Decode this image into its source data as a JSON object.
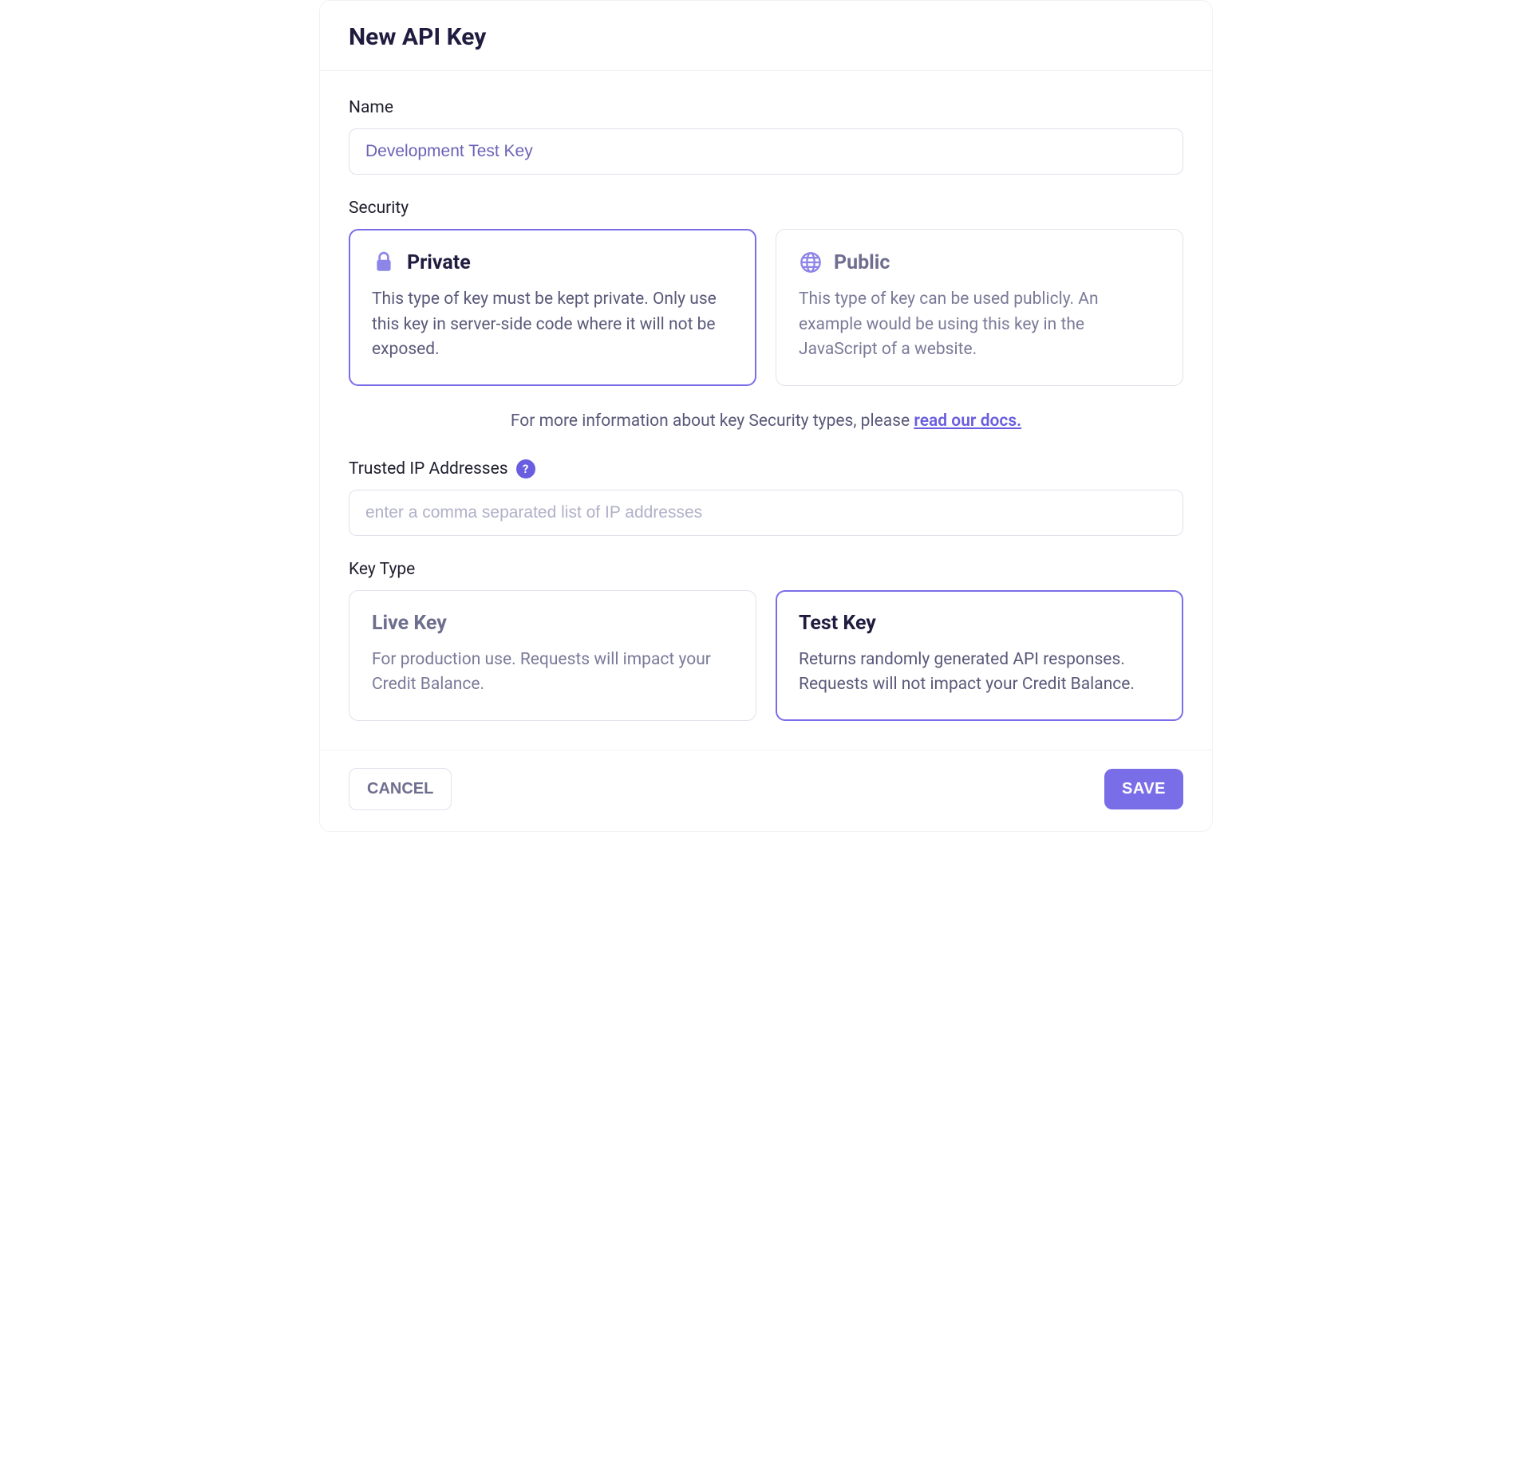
{
  "header": {
    "title": "New API Key"
  },
  "nameField": {
    "label": "Name",
    "value": "Development Test Key"
  },
  "security": {
    "label": "Security",
    "options": [
      {
        "title": "Private",
        "desc": "This type of key must be kept private. Only use this key in server-side code where it will not be exposed.",
        "selected": true
      },
      {
        "title": "Public",
        "desc": "This type of key can be used publicly. An example would be using this key in the JavaScript of a website.",
        "selected": false
      }
    ],
    "info_prefix": "For more information about key Security types, please ",
    "info_link": "read our docs."
  },
  "trustedIp": {
    "label": "Trusted IP Addresses",
    "placeholder": "enter a comma separated list of IP addresses",
    "help": "?"
  },
  "keyType": {
    "label": "Key Type",
    "options": [
      {
        "title": "Live Key",
        "desc": "For production use. Requests will impact your Credit Balance.",
        "selected": false
      },
      {
        "title": "Test Key",
        "desc": "Returns randomly generated API responses. Requests will not impact your Credit Balance.",
        "selected": true
      }
    ]
  },
  "footer": {
    "cancel": "CANCEL",
    "save": "SAVE"
  }
}
